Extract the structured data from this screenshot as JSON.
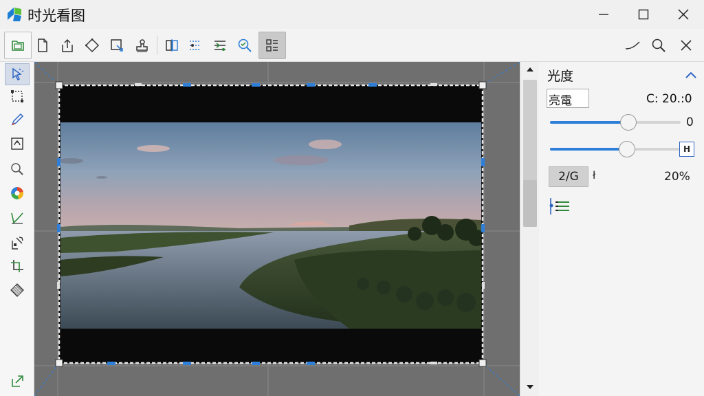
{
  "app": {
    "title": "时光看图",
    "brand_colors": {
      "accent": "#2f7fd8",
      "logo_blue": "#1b7fd3",
      "logo_green": "#5cc13a"
    }
  },
  "window_controls": [
    {
      "name": "minimize-icon"
    },
    {
      "name": "maximize-icon"
    },
    {
      "name": "close-icon"
    }
  ],
  "toolbar": {
    "left_tools": [
      {
        "name": "open-folder-icon",
        "active": false
      },
      {
        "name": "new-file-icon",
        "active": false
      },
      {
        "name": "export-icon",
        "active": false
      },
      {
        "name": "rotate-icon",
        "active": false
      },
      {
        "name": "crop-resize-icon",
        "active": false
      },
      {
        "name": "stamp-icon",
        "active": false
      },
      {
        "name": "compare-icon",
        "active": false
      },
      {
        "name": "select-region-icon",
        "active": false
      },
      {
        "name": "adjust-icon",
        "active": false
      },
      {
        "name": "zoom-search-icon",
        "active": false
      },
      {
        "name": "layout-panel-icon",
        "active": true
      }
    ],
    "right_tools": [
      {
        "name": "curve-icon"
      },
      {
        "name": "search-icon"
      },
      {
        "name": "close-panel-icon"
      }
    ]
  },
  "side_tools": [
    {
      "name": "pointer-tool-icon",
      "active": true
    },
    {
      "name": "marquee-tool-icon",
      "active": false
    },
    {
      "name": "pencil-tool-icon",
      "active": false
    },
    {
      "name": "stamp-tool-icon",
      "active": false
    },
    {
      "name": "magnifier-tool-icon",
      "active": false
    },
    {
      "name": "color-wheel-tool-icon",
      "active": false
    },
    {
      "name": "curve-tool-icon",
      "active": false
    },
    {
      "name": "transform-tool-icon",
      "active": false
    },
    {
      "name": "crop-tool-icon",
      "active": false
    },
    {
      "name": "texture-tool-icon",
      "active": false
    },
    {
      "name": "export-tool-icon",
      "active": false
    }
  ],
  "panel": {
    "title": "光度",
    "preset_value": "亮電",
    "c_value": "C: 20.:0",
    "slider1": {
      "value": 0.6,
      "display": "0"
    },
    "slider2": {
      "value": 0.6
    },
    "lock_label": "H",
    "ratio_label": "2/G",
    "ratio_mark": "ł",
    "percent": "20%"
  }
}
